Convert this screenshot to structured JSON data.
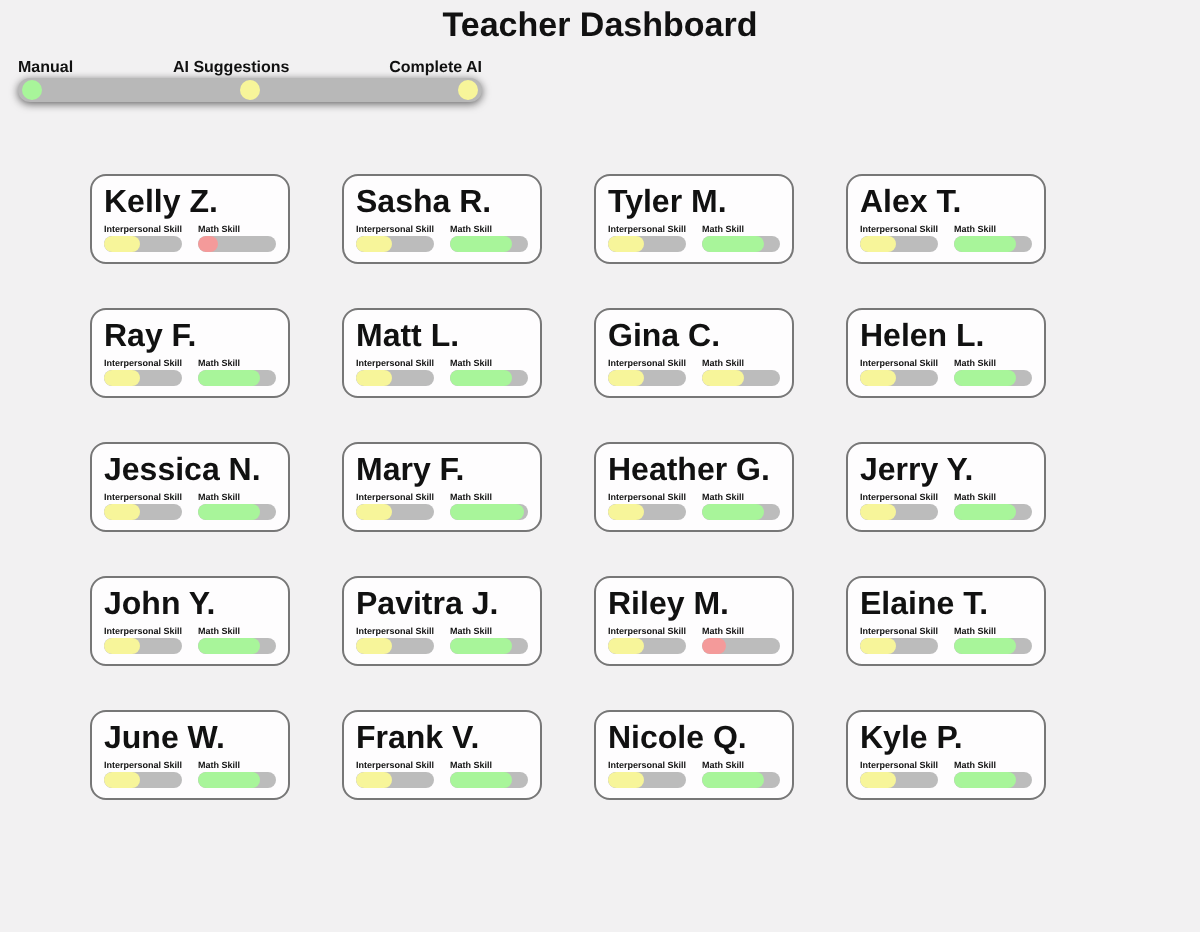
{
  "title": "Teacher Dashboard",
  "mode_slider": {
    "stops": [
      {
        "label": "Manual",
        "color": "#a8f59a"
      },
      {
        "label": "AI Suggestions",
        "color": "#f7f59a"
      },
      {
        "label": "Complete AI",
        "color": "#f7f59a"
      }
    ]
  },
  "students": [
    {
      "name": "Kelly Z.",
      "skills": [
        {
          "label": "Interpersonal Skill",
          "level": 0.45,
          "color": "#f7f59a"
        },
        {
          "label": "Math Skill",
          "level": 0.25,
          "color": "#f49a9a"
        }
      ]
    },
    {
      "name": "Sasha R.",
      "skills": [
        {
          "label": "Interpersonal Skill",
          "level": 0.45,
          "color": "#f7f59a"
        },
        {
          "label": "Math Skill",
          "level": 0.8,
          "color": "#a8f59a"
        }
      ]
    },
    {
      "name": "Tyler M.",
      "skills": [
        {
          "label": "Interpersonal Skill",
          "level": 0.45,
          "color": "#f7f59a"
        },
        {
          "label": "Math Skill",
          "level": 0.8,
          "color": "#a8f59a"
        }
      ]
    },
    {
      "name": "Alex T.",
      "skills": [
        {
          "label": "Interpersonal Skill",
          "level": 0.45,
          "color": "#f7f59a"
        },
        {
          "label": "Math Skill",
          "level": 0.8,
          "color": "#a8f59a"
        }
      ]
    },
    {
      "name": "Ray F.",
      "skills": [
        {
          "label": "Interpersonal Skill",
          "level": 0.45,
          "color": "#f7f59a"
        },
        {
          "label": "Math Skill",
          "level": 0.8,
          "color": "#a8f59a"
        }
      ]
    },
    {
      "name": "Matt L.",
      "skills": [
        {
          "label": "Interpersonal Skill",
          "level": 0.45,
          "color": "#f7f59a"
        },
        {
          "label": "Math Skill",
          "level": 0.8,
          "color": "#a8f59a"
        }
      ]
    },
    {
      "name": "Gina C.",
      "skills": [
        {
          "label": "Interpersonal Skill",
          "level": 0.45,
          "color": "#f7f59a"
        },
        {
          "label": "Math Skill",
          "level": 0.55,
          "color": "#f7f59a"
        }
      ]
    },
    {
      "name": "Helen L.",
      "skills": [
        {
          "label": "Interpersonal Skill",
          "level": 0.45,
          "color": "#f7f59a"
        },
        {
          "label": "Math Skill",
          "level": 0.8,
          "color": "#a8f59a"
        }
      ]
    },
    {
      "name": "Jessica N.",
      "skills": [
        {
          "label": "Interpersonal Skill",
          "level": 0.45,
          "color": "#f7f59a"
        },
        {
          "label": "Math Skill",
          "level": 0.8,
          "color": "#a8f59a"
        }
      ]
    },
    {
      "name": "Mary F.",
      "skills": [
        {
          "label": "Interpersonal Skill",
          "level": 0.45,
          "color": "#f7f59a"
        },
        {
          "label": "Math Skill",
          "level": 0.95,
          "color": "#a8f59a"
        }
      ]
    },
    {
      "name": "Heather G.",
      "skills": [
        {
          "label": "Interpersonal Skill",
          "level": 0.45,
          "color": "#f7f59a"
        },
        {
          "label": "Math Skill",
          "level": 0.8,
          "color": "#a8f59a"
        }
      ]
    },
    {
      "name": "Jerry Y.",
      "skills": [
        {
          "label": "Interpersonal Skill",
          "level": 0.45,
          "color": "#f7f59a"
        },
        {
          "label": "Math Skill",
          "level": 0.8,
          "color": "#a8f59a"
        }
      ]
    },
    {
      "name": "John Y.",
      "skills": [
        {
          "label": "Interpersonal Skill",
          "level": 0.45,
          "color": "#f7f59a"
        },
        {
          "label": "Math Skill",
          "level": 0.8,
          "color": "#a8f59a"
        }
      ]
    },
    {
      "name": "Pavitra J.",
      "skills": [
        {
          "label": "Interpersonal Skill",
          "level": 0.45,
          "color": "#f7f59a"
        },
        {
          "label": "Math Skill",
          "level": 0.8,
          "color": "#a8f59a"
        }
      ]
    },
    {
      "name": "Riley M.",
      "skills": [
        {
          "label": "Interpersonal Skill",
          "level": 0.45,
          "color": "#f7f59a"
        },
        {
          "label": "Math Skill",
          "level": 0.3,
          "color": "#f49a9a"
        }
      ]
    },
    {
      "name": "Elaine T.",
      "skills": [
        {
          "label": "Interpersonal Skill",
          "level": 0.45,
          "color": "#f7f59a"
        },
        {
          "label": "Math Skill",
          "level": 0.8,
          "color": "#a8f59a"
        }
      ]
    },
    {
      "name": "June W.",
      "skills": [
        {
          "label": "Interpersonal Skill",
          "level": 0.45,
          "color": "#f7f59a"
        },
        {
          "label": "Math Skill",
          "level": 0.8,
          "color": "#a8f59a"
        }
      ]
    },
    {
      "name": "Frank V.",
      "skills": [
        {
          "label": "Interpersonal Skill",
          "level": 0.45,
          "color": "#f7f59a"
        },
        {
          "label": "Math Skill",
          "level": 0.8,
          "color": "#a8f59a"
        }
      ]
    },
    {
      "name": "Nicole Q.",
      "skills": [
        {
          "label": "Interpersonal Skill",
          "level": 0.45,
          "color": "#f7f59a"
        },
        {
          "label": "Math Skill",
          "level": 0.8,
          "color": "#a8f59a"
        }
      ]
    },
    {
      "name": "Kyle P.",
      "skills": [
        {
          "label": "Interpersonal Skill",
          "level": 0.45,
          "color": "#f7f59a"
        },
        {
          "label": "Math Skill",
          "level": 0.8,
          "color": "#a8f59a"
        }
      ]
    }
  ]
}
